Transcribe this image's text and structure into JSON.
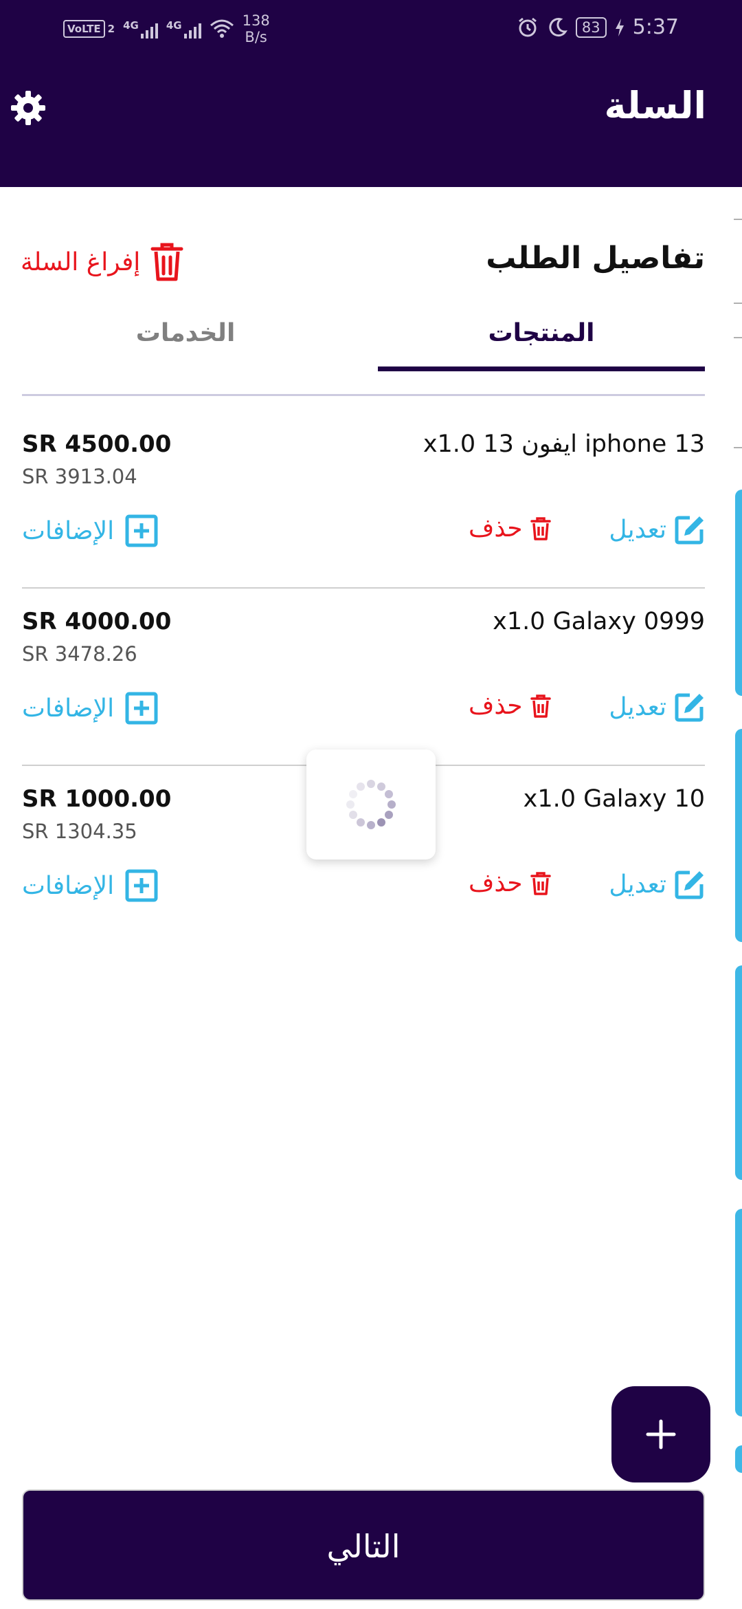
{
  "status_bar": {
    "volte": "VoLTE",
    "sim_index": "2",
    "network_1": "4G",
    "network_2": "4G",
    "speed_value": "138",
    "speed_unit": "B/s",
    "battery": "83",
    "time": "5:37"
  },
  "header": {
    "title": "السلة",
    "settings_icon": "gear-icon"
  },
  "order": {
    "title": "تفاصيل الطلب",
    "empty_cart_label": "إفراغ السلة"
  },
  "tabs": [
    {
      "label": "المنتجات",
      "active": true
    },
    {
      "label": "الخدمات",
      "active": false
    }
  ],
  "items": [
    {
      "name": "x1.0 ايفون 13 iphone 13",
      "price": "SR 4500.00",
      "sub_price": "SR 3913.04",
      "edit_label": "تعديل",
      "delete_label": "حذف",
      "addons_label": "الإضافات"
    },
    {
      "name": "x1.0 Galaxy 0999",
      "price": "SR 4000.00",
      "sub_price": "SR 3478.26",
      "edit_label": "تعديل",
      "delete_label": "حذف",
      "addons_label": "الإضافات"
    },
    {
      "name": "x1.0 Galaxy 10",
      "price": "SR 1000.00",
      "sub_price": "SR 1304.35",
      "edit_label": "تعديل",
      "delete_label": "حذف",
      "addons_label": "الإضافات"
    }
  ],
  "fab_icon": "plus-icon",
  "next_button": "التالي",
  "colors": {
    "primary": "#1f0245",
    "accent": "#33b5e5",
    "danger": "#e8141c"
  }
}
